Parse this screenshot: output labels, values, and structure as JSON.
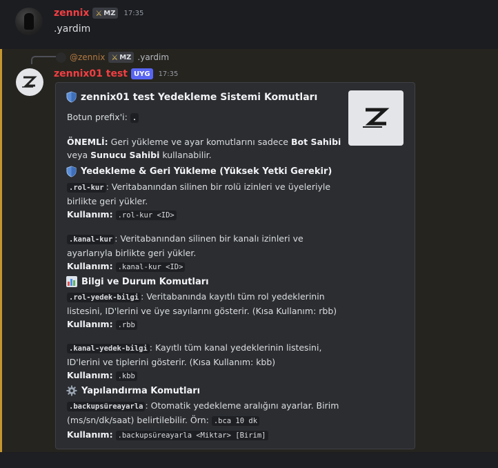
{
  "colors": {
    "author1": "#f23f43",
    "author2": "#f23f43",
    "mention": "#b27a43",
    "highlight_border": "#c59732",
    "app_badge": "#5865f2"
  },
  "message1": {
    "author": "zennix",
    "tag": "MZ",
    "tag_icon": "sword-icon",
    "time": "17:35",
    "text": ".yardim"
  },
  "message2": {
    "reply": {
      "mention": "@zennix",
      "tag": "MZ",
      "text": ".yardim"
    },
    "author": "zennix01 test",
    "badge": "UYG",
    "time": "17:35",
    "embed": {
      "title": "zennix01 test Yedekleme Sistemi Komutları",
      "prefix_label": "Botun prefix'i:",
      "prefix": ".",
      "important_label": "ÖNEMLİ:",
      "important_text1": "Geri yükleme ve ayar komutlarını sadece",
      "bot_owner": "Bot Sahibi",
      "important_text2": "veya",
      "server_owner": "Sunucu Sahibi",
      "important_text3": "kullanabilir.",
      "usage_label": "Kullanım:",
      "sections": {
        "backup": {
          "title": "Yedekleme & Geri Yükleme (Yüksek Yetki Gerekir)",
          "cmd1": ".rol-kur",
          "cmd1_desc_a": ": Veritabanından silinen bir rolü izinleri ve üyeleriyle",
          "cmd1_desc_b": "birlikte geri yükler.",
          "cmd1_usage": ".rol-kur <ID>",
          "cmd2": ".kanal-kur",
          "cmd2_desc_a": ": Veritabanından silinen bir kanalı izinleri ve",
          "cmd2_desc_b": "ayarlarıyla birlikte geri yükler.",
          "cmd2_usage": ".kanal-kur <ID>"
        },
        "info": {
          "title": "Bilgi ve Durum Komutları",
          "cmd1": ".rol-yedek-bilgi",
          "cmd1_desc_a": ": Veritabanında kayıtlı tüm rol yedeklerinin",
          "cmd1_desc_b": "listesini, ID'lerini ve üye sayılarını gösterir. (Kısa Kullanım: rbb)",
          "cmd1_usage": ".rbb",
          "cmd2": ".kanal-yedek-bilgi",
          "cmd2_desc_a": ": Kayıtlı tüm kanal yedeklerinin listesini,",
          "cmd2_desc_b": "ID'lerini ve tiplerini gösterir. (Kısa Kullanım: kbb)",
          "cmd2_usage": ".kbb"
        },
        "config": {
          "title": "Yapılandırma Komutları",
          "cmd1": ".backupsüreayarla",
          "cmd1_desc_a": ": Otomatik yedekleme aralığını ayarlar. Birim",
          "cmd1_desc_b": "(ms/sn/dk/saat) belirtilebilir. Örn:",
          "cmd1_example": ".bca 10 dk",
          "cmd1_usage": ".backupsüreayarla <Miktar> [Birim]"
        }
      }
    }
  }
}
